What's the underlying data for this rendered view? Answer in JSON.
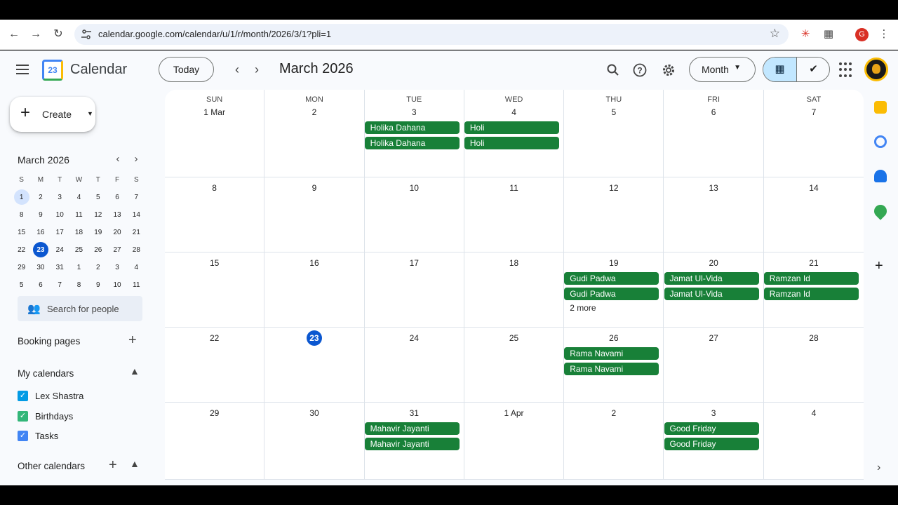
{
  "browser": {
    "url": "calendar.google.com/calendar/u/1/r/month/2026/3/1?pli=1",
    "profile_letter": "G"
  },
  "app": {
    "title": "Calendar",
    "logo_day": "23",
    "today_label": "Today",
    "month_title": "March 2026",
    "view_label": "Month"
  },
  "sidebar": {
    "create_label": "Create",
    "mini_title": "March 2026",
    "weekday_heads": [
      "S",
      "M",
      "T",
      "W",
      "T",
      "F",
      "S"
    ],
    "mini_weeks": [
      [
        "1",
        "2",
        "3",
        "4",
        "5",
        "6",
        "7"
      ],
      [
        "8",
        "9",
        "10",
        "11",
        "12",
        "13",
        "14"
      ],
      [
        "15",
        "16",
        "17",
        "18",
        "19",
        "20",
        "21"
      ],
      [
        "22",
        "23",
        "24",
        "25",
        "26",
        "27",
        "28"
      ],
      [
        "29",
        "30",
        "31",
        "1",
        "2",
        "3",
        "4"
      ],
      [
        "5",
        "6",
        "7",
        "8",
        "9",
        "10",
        "11"
      ]
    ],
    "people_search_placeholder": "Search for people",
    "booking_pages": "Booking pages",
    "my_calendars": "My calendars",
    "calendars": [
      {
        "name": "Lex Shastra",
        "color": "#039be5"
      },
      {
        "name": "Birthdays",
        "color": "#33b679"
      },
      {
        "name": "Tasks",
        "color": "#4285f4"
      }
    ],
    "other_calendars": "Other calendars"
  },
  "grid": {
    "weekdays": [
      "SUN",
      "MON",
      "TUE",
      "WED",
      "THU",
      "FRI",
      "SAT"
    ],
    "weeks": [
      [
        "1 Mar",
        "2",
        "3",
        "4",
        "5",
        "6",
        "7"
      ],
      [
        "8",
        "9",
        "10",
        "11",
        "12",
        "13",
        "14"
      ],
      [
        "15",
        "16",
        "17",
        "18",
        "19",
        "20",
        "21"
      ],
      [
        "22",
        "23",
        "24",
        "25",
        "26",
        "27",
        "28"
      ],
      [
        "29",
        "30",
        "31",
        "1 Apr",
        "2",
        "3",
        "4"
      ]
    ],
    "events": [
      {
        "week": 0,
        "day": 2,
        "titles": [
          "Holika Dahana",
          "Holika Dahana"
        ]
      },
      {
        "week": 0,
        "day": 3,
        "titles": [
          "Holi",
          "Holi"
        ]
      },
      {
        "week": 2,
        "day": 4,
        "titles": [
          "Gudi Padwa",
          "Gudi Padwa"
        ],
        "more": "2 more"
      },
      {
        "week": 2,
        "day": 5,
        "titles": [
          "Jamat Ul-Vida",
          "Jamat Ul-Vida"
        ]
      },
      {
        "week": 2,
        "day": 6,
        "titles": [
          "Ramzan Id",
          "Ramzan Id"
        ]
      },
      {
        "week": 3,
        "day": 4,
        "titles": [
          "Rama Navami",
          "Rama Navami"
        ]
      },
      {
        "week": 4,
        "day": 2,
        "titles": [
          "Mahavir Jayanti",
          "Mahavir Jayanti"
        ]
      },
      {
        "week": 4,
        "day": 5,
        "titles": [
          "Good Friday",
          "Good Friday"
        ]
      }
    ],
    "event_color": "#188038",
    "today_color": "#0b57d0"
  }
}
